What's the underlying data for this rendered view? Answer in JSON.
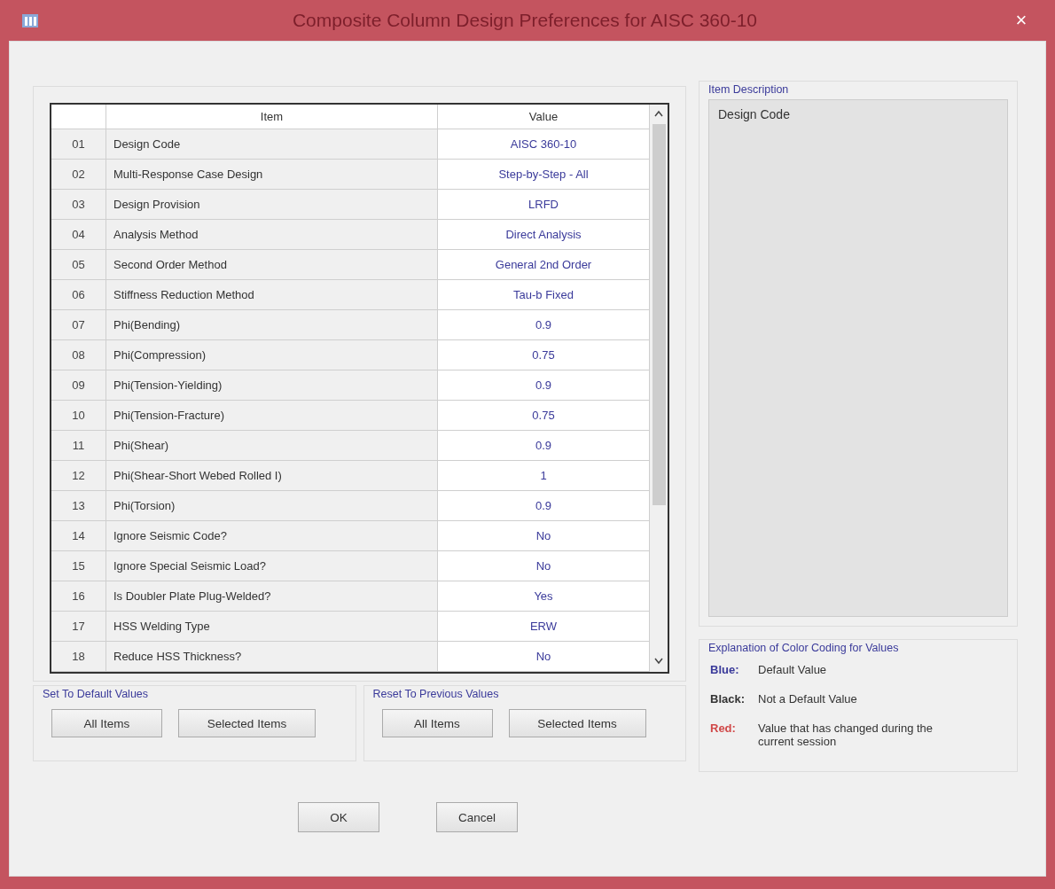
{
  "window": {
    "title": "Composite Column Design Preferences for AISC 360-10",
    "close": "×"
  },
  "table": {
    "columns": [
      "Item",
      "Value"
    ],
    "rows": [
      {
        "number": "01",
        "item": "Design Code",
        "value": "AISC 360-10",
        "kind": "default"
      },
      {
        "number": "02",
        "item": "Multi-Response Case Design",
        "value": "Step-by-Step - All",
        "kind": "default"
      },
      {
        "number": "03",
        "item": "Design Provision",
        "value": "LRFD",
        "kind": "default"
      },
      {
        "number": "04",
        "item": "Analysis Method",
        "value": "Direct Analysis",
        "kind": "default"
      },
      {
        "number": "05",
        "item": "Second Order Method",
        "value": "General 2nd Order",
        "kind": "default"
      },
      {
        "number": "06",
        "item": "Stiffness Reduction Method",
        "value": "Tau-b Fixed",
        "kind": "default"
      },
      {
        "number": "07",
        "item": "Phi(Bending)",
        "value": "0.9",
        "kind": "default"
      },
      {
        "number": "08",
        "item": "Phi(Compression)",
        "value": "0.75",
        "kind": "default"
      },
      {
        "number": "09",
        "item": "Phi(Tension-Yielding)",
        "value": "0.9",
        "kind": "default"
      },
      {
        "number": "10",
        "item": "Phi(Tension-Fracture)",
        "value": "0.75",
        "kind": "default"
      },
      {
        "number": "11",
        "item": "Phi(Shear)",
        "value": "0.9",
        "kind": "default"
      },
      {
        "number": "12",
        "item": "Phi(Shear-Short Webed Rolled I)",
        "value": "1",
        "kind": "default"
      },
      {
        "number": "13",
        "item": "Phi(Torsion)",
        "value": "0.9",
        "kind": "default"
      },
      {
        "number": "14",
        "item": "Ignore Seismic Code?",
        "value": "No",
        "kind": "default"
      },
      {
        "number": "15",
        "item": "Ignore Special Seismic Load?",
        "value": "No",
        "kind": "default"
      },
      {
        "number": "16",
        "item": "Is Doubler Plate Plug-Welded?",
        "value": "Yes",
        "kind": "default"
      },
      {
        "number": "17",
        "item": "HSS Welding Type",
        "value": "ERW",
        "kind": "default"
      },
      {
        "number": "18",
        "item": "Reduce HSS Thickness?",
        "value": "No",
        "kind": "default"
      }
    ]
  },
  "item_description": {
    "title": "Item Description",
    "text": "Design Code"
  },
  "color_coding": {
    "title": "Explanation of Color Coding for Values",
    "items": [
      {
        "label": "Blue:",
        "text": "Default Value",
        "color": "#3a3a9a"
      },
      {
        "label": "Black:",
        "text": "Not a Default Value",
        "color": "#333333"
      },
      {
        "label": "Red:",
        "text": "Value that has changed during the current session",
        "color": "#d04848"
      }
    ]
  },
  "set_to_default": {
    "title": "Set To Default Values",
    "buttons": [
      "All Items",
      "Selected Items"
    ]
  },
  "reset_to_previous": {
    "title": "Reset To Previous Values",
    "buttons": [
      "All Items",
      "Selected Items"
    ]
  },
  "buttons": [
    "OK",
    "Cancel"
  ]
}
